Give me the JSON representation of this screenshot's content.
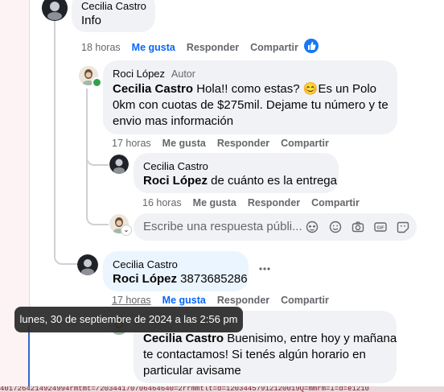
{
  "comments": [
    {
      "author": "Cecilia Castro",
      "text": "Info",
      "time": "18 horas",
      "like": "Me gusta",
      "reply": "Responder",
      "share": "Compartir",
      "reaction_icon": "like-reaction-icon"
    },
    {
      "author": "Roci López",
      "author_badge": "Autor",
      "mention": "Cecilia Castro",
      "text_lines": [
        " Hola!! como estas? ",
        "Es un Polo",
        "0km con cuotas de $275mil. Dejame tu número y te",
        "envio mas información"
      ],
      "emoji": "😊",
      "time": "17 horas",
      "like": "Me gusta",
      "reply": "Responder",
      "share": "Compartir"
    },
    {
      "author": "Cecilia Castro",
      "mention": "Roci López",
      "text": " de cuánto es la entrega",
      "time": "16 horas",
      "like": "Me gusta",
      "reply": "Responder",
      "share": "Compartir"
    },
    {
      "author": "Cecilia Castro",
      "mention": "Roci López",
      "text": " 3873685286",
      "time": "17 horas",
      "like": "Me gusta",
      "reply": "Responder",
      "share": "Compartir",
      "more_icon": "more-options-icon"
    },
    {
      "mention": "Cecilia Castro",
      "text_lines": [
        " Buenisimo, entre hoy y mañana",
        "te contactamos! Si tenés algún horario en",
        "particular avisame"
      ]
    }
  ],
  "reply_box": {
    "placeholder": "Escribe una respuesta públi...",
    "icons": [
      "avatar-sticker-icon",
      "emoji-icon",
      "camera-icon",
      "gif-icon",
      "sticker-icon"
    ]
  },
  "tooltip": "lunes, 30 de septiembre de 2024 a las 2:56 pm",
  "status_url": "4017264214924994rmtmt=/20344170706464640=2rrmmtlt=d=12034457912120019Q=mmrm=I=d=e1210"
}
